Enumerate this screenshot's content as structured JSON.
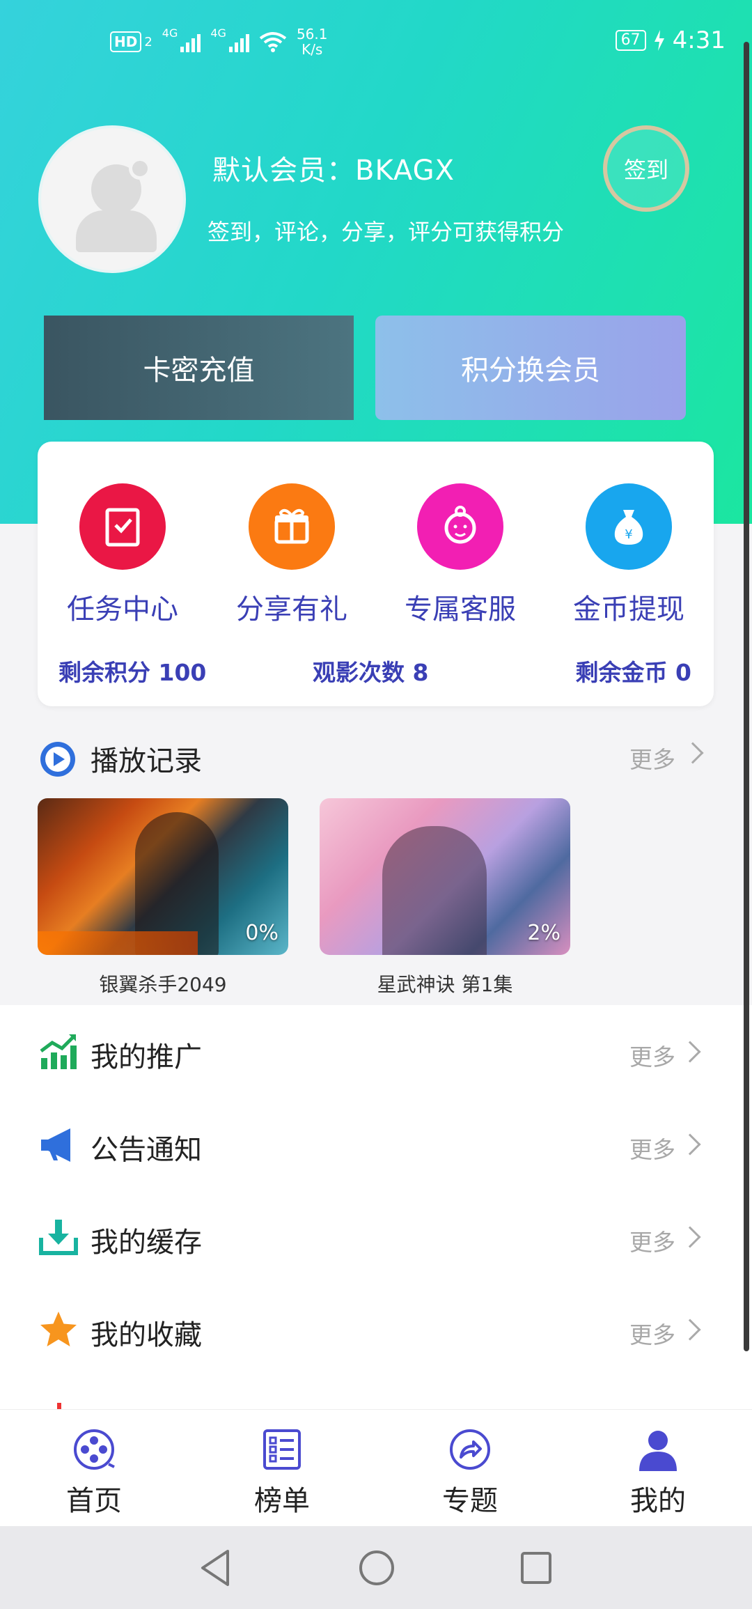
{
  "status_bar": {
    "hd": "HD",
    "sim": "2",
    "net_a": "4G",
    "net_b": "4G",
    "speed_value": "56.1",
    "speed_unit": "K/s",
    "battery": "67",
    "time": "4:31"
  },
  "profile": {
    "username": "默认会员：BKAGX",
    "tagline": "签到，评论，分享，评分可获得积分",
    "signin_label": "签到"
  },
  "actions": {
    "card_recharge": "卡密充值",
    "points_to_vip": "积分换会员"
  },
  "features": [
    {
      "label": "任务中心",
      "icon": "task-icon",
      "color": "#ea1745"
    },
    {
      "label": "分享有礼",
      "icon": "gift-icon",
      "color": "#fb7a12"
    },
    {
      "label": "专属客服",
      "icon": "service-icon",
      "color": "#f21fb3"
    },
    {
      "label": "金币提现",
      "icon": "money-bag-icon",
      "color": "#18a6ee"
    }
  ],
  "stats": {
    "points": "剩余积分  100",
    "views": "观影次数  8",
    "coins": "剩余金币  0"
  },
  "history": {
    "title": "播放记录",
    "more": "更多",
    "items": [
      {
        "caption": "银翼杀手2049",
        "progress": "0%"
      },
      {
        "caption": "星武神诀 第1集",
        "progress": "2%"
      }
    ]
  },
  "menu": [
    {
      "title": "我的推广",
      "more": "更多",
      "icon": "chart-icon"
    },
    {
      "title": "公告通知",
      "more": "更多",
      "icon": "megaphone-icon"
    },
    {
      "title": "我的缓存",
      "more": "更多",
      "icon": "download-icon"
    },
    {
      "title": "我的收藏",
      "more": "更多",
      "icon": "star-icon"
    }
  ],
  "tabs": [
    {
      "label": "首页",
      "icon": "film-reel-icon"
    },
    {
      "label": "榜单",
      "icon": "list-icon"
    },
    {
      "label": "专题",
      "icon": "share-arrow-icon"
    },
    {
      "label": "我的",
      "icon": "person-icon",
      "active": true
    }
  ],
  "colors": {
    "accent": "#3a3fb5",
    "hero_start": "#35d2dc",
    "hero_end": "#1be6a0"
  }
}
